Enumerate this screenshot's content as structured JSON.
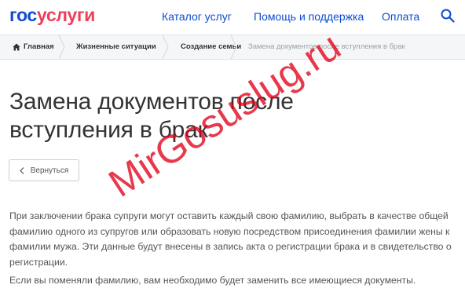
{
  "header": {
    "logo": {
      "part1": "гос",
      "part2": "услуги"
    },
    "nav": {
      "catalog": "Каталог услуг",
      "help": "Помощь и поддержка",
      "payment": "Оплата"
    },
    "search_icon": "search-icon"
  },
  "breadcrumbs": {
    "home_icon": "home-icon",
    "items": [
      "Главная",
      "Жизненные ситуации",
      "Создание семьи"
    ],
    "current": "Замена документов после вступления в брак"
  },
  "main": {
    "title": "Замена документов после вступления в брак",
    "back_label": "Вернуться",
    "paragraphs": [
      "При заключении брака супруги могут оставить каждый свою фамилию, выбрать в качестве общей фамилию одного из супругов или образовать новую посредством присоединения фамилии жены к фамилии мужа. Эти данные будут внесены в запись акта о регистрации брака и в свидетельство о регистрации.",
      "Если вы поменяли фамилию, вам необходимо будет заменить все имеющиеся документы."
    ]
  },
  "watermark": "MirGosuslug.ru",
  "colors": {
    "brand_blue": "#0d4cd3",
    "brand_red": "#ee3f58",
    "watermark_red": "#e2001a"
  }
}
